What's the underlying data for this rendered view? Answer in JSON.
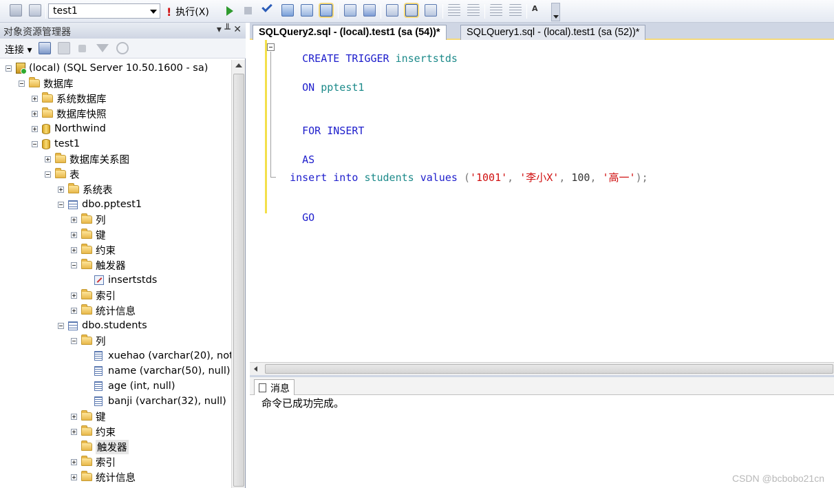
{
  "toolbar": {
    "database": "test1",
    "execute_label": "执行(X)"
  },
  "explorer": {
    "title": "对象资源管理器",
    "controls": "▾ ╨ ✕",
    "connect_label": "连接",
    "tree": [
      {
        "label": "(local) (SQL Server 10.50.1600 - sa)",
        "icon": "server-icon",
        "expander": "minus"
      },
      {
        "label": "数据库",
        "icon": "folder-icon",
        "expander": "minus"
      },
      {
        "label": "系统数据库",
        "icon": "folder-icon",
        "expander": "plus"
      },
      {
        "label": "数据库快照",
        "icon": "folder-icon",
        "expander": "plus"
      },
      {
        "label": "Northwind",
        "icon": "database-icon",
        "expander": "plus"
      },
      {
        "label": "test1",
        "icon": "database-icon",
        "expander": "minus"
      },
      {
        "label": "数据库关系图",
        "icon": "folder-icon",
        "expander": "plus"
      },
      {
        "label": "表",
        "icon": "folder-icon",
        "expander": "minus"
      },
      {
        "label": "系统表",
        "icon": "folder-icon",
        "expander": "plus"
      },
      {
        "label": "dbo.pptest1",
        "icon": "table-icon",
        "expander": "minus"
      },
      {
        "label": "列",
        "icon": "folder-icon",
        "expander": "plus"
      },
      {
        "label": "键",
        "icon": "folder-icon",
        "expander": "plus"
      },
      {
        "label": "约束",
        "icon": "folder-icon",
        "expander": "plus"
      },
      {
        "label": "触发器",
        "icon": "folder-icon",
        "expander": "minus"
      },
      {
        "label": "insertstds",
        "icon": "trigger-icon",
        "expander": "none"
      },
      {
        "label": "索引",
        "icon": "folder-icon",
        "expander": "plus"
      },
      {
        "label": "统计信息",
        "icon": "folder-icon",
        "expander": "plus"
      },
      {
        "label": "dbo.students",
        "icon": "table-icon",
        "expander": "minus"
      },
      {
        "label": "列",
        "icon": "folder-icon",
        "expander": "minus"
      },
      {
        "label": "xuehao (varchar(20), not",
        "icon": "column-icon",
        "expander": "none"
      },
      {
        "label": "name (varchar(50), null)",
        "icon": "column-icon",
        "expander": "none"
      },
      {
        "label": "age (int, null)",
        "icon": "column-icon",
        "expander": "none"
      },
      {
        "label": "banji (varchar(32), null)",
        "icon": "column-icon",
        "expander": "none"
      },
      {
        "label": "键",
        "icon": "folder-icon",
        "expander": "plus"
      },
      {
        "label": "约束",
        "icon": "folder-icon",
        "expander": "plus"
      },
      {
        "label": "触发器",
        "icon": "folder-icon",
        "expander": "none",
        "selected": true
      },
      {
        "label": "索引",
        "icon": "folder-icon",
        "expander": "plus"
      },
      {
        "label": "统计信息",
        "icon": "folder-icon",
        "expander": "plus"
      }
    ]
  },
  "editor": {
    "tabs": [
      {
        "label": "SQLQuery2.sql - (local).test1 (sa (54))*",
        "active": true
      },
      {
        "label": "SQLQuery1.sql - (local).test1 (sa (52))*",
        "active": false
      }
    ],
    "code": {
      "line1_kw": "CREATE TRIGGER",
      "line1_id": "insertstds",
      "line2_kw": "ON",
      "line2_id": "pptest1",
      "line3_kw": "FOR INSERT",
      "line4_kw": "AS",
      "line5_kw1": "insert into",
      "line5_id": "students",
      "line5_kw2": "values",
      "line5_v1": "'1001'",
      "line5_v2": "'李小X'",
      "line5_v3": "100",
      "line5_v4": "'高一'",
      "line6_kw": "GO"
    }
  },
  "results": {
    "tab_label": "消息",
    "message": "命令已成功完成。"
  },
  "watermark": "CSDN @bcbobo21cn"
}
